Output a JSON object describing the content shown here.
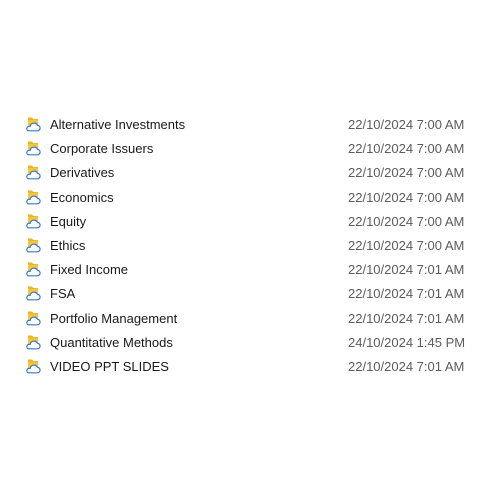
{
  "file_list": {
    "icon": "onedrive-folder-icon",
    "colors": {
      "folder": "#f5c842",
      "cloud_stroke": "#3a78c9",
      "name_text": "#1a1a1a",
      "date_text": "#5c5c5c"
    },
    "rows": [
      {
        "name": "Alternative Investments",
        "modified": "22/10/2024 7:00 AM"
      },
      {
        "name": "Corporate Issuers",
        "modified": "22/10/2024 7:00 AM"
      },
      {
        "name": "Derivatives",
        "modified": "22/10/2024 7:00 AM"
      },
      {
        "name": "Economics",
        "modified": "22/10/2024 7:00 AM"
      },
      {
        "name": "Equity",
        "modified": "22/10/2024 7:00 AM"
      },
      {
        "name": "Ethics",
        "modified": "22/10/2024 7:00 AM"
      },
      {
        "name": "Fixed Income",
        "modified": "22/10/2024 7:01 AM"
      },
      {
        "name": "FSA",
        "modified": "22/10/2024 7:01 AM"
      },
      {
        "name": "Portfolio Management",
        "modified": "22/10/2024 7:01 AM"
      },
      {
        "name": "Quantitative Methods",
        "modified": "24/10/2024 1:45 PM"
      },
      {
        "name": "VIDEO PPT SLIDES",
        "modified": "22/10/2024 7:01 AM"
      }
    ]
  }
}
